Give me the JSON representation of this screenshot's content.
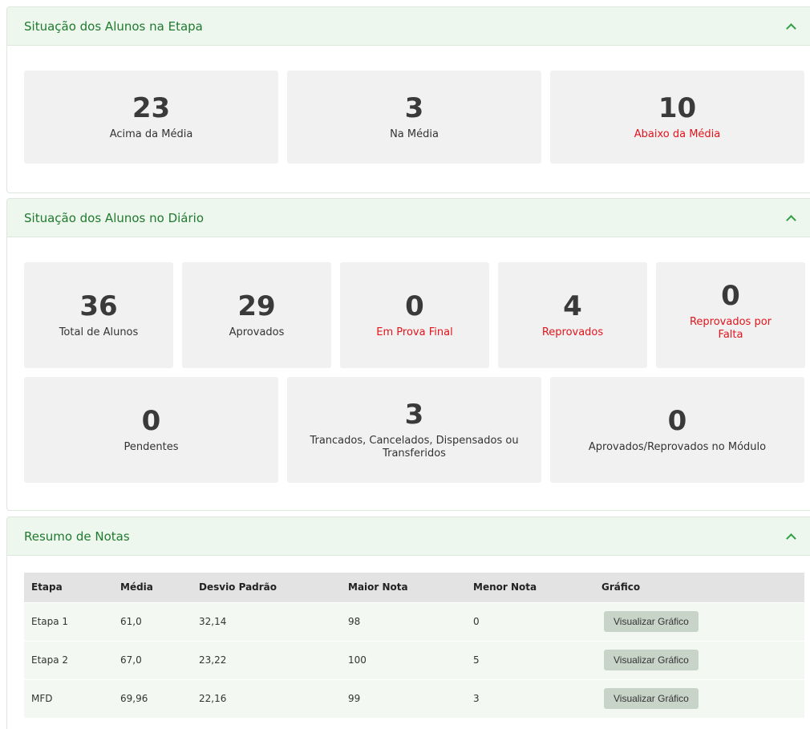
{
  "etapa_panel": {
    "title": "Situação dos Alunos na Etapa",
    "stats": [
      {
        "value": "23",
        "label": "Acima da Média",
        "alert": false
      },
      {
        "value": "3",
        "label": "Na Média",
        "alert": false
      },
      {
        "value": "10",
        "label": "Abaixo da Média",
        "alert": true
      }
    ]
  },
  "diario_panel": {
    "title": "Situação dos Alunos no Diário",
    "row1": [
      {
        "value": "36",
        "label": "Total de Alunos",
        "alert": false
      },
      {
        "value": "29",
        "label": "Aprovados",
        "alert": false
      },
      {
        "value": "0",
        "label": "Em Prova Final",
        "alert": true
      },
      {
        "value": "4",
        "label": "Reprovados",
        "alert": true
      },
      {
        "value": "0",
        "label": "Reprovados por Falta",
        "alert": true
      }
    ],
    "row2": [
      {
        "value": "0",
        "label": "Pendentes",
        "alert": false
      },
      {
        "value": "3",
        "label": "Trancados, Cancelados, Dispensados ou Transferidos",
        "alert": false
      },
      {
        "value": "0",
        "label": "Aprovados/Reprovados no Módulo",
        "alert": false
      }
    ]
  },
  "resumo_panel": {
    "title": "Resumo de Notas",
    "columns": [
      "Etapa",
      "Média",
      "Desvio Padrão",
      "Maior Nota",
      "Menor Nota",
      "Gráfico"
    ],
    "rows": [
      {
        "etapa": "Etapa 1",
        "media": "61,0",
        "desvio": "32,14",
        "maior": "98",
        "menor": "0",
        "button": "Visualizar Gráfico"
      },
      {
        "etapa": "Etapa 2",
        "media": "67,0",
        "desvio": "23,22",
        "maior": "100",
        "menor": "5",
        "button": "Visualizar Gráfico"
      },
      {
        "etapa": "MFD",
        "media": "69,96",
        "desvio": "22,16",
        "maior": "99",
        "menor": "3",
        "button": "Visualizar Gráfico"
      }
    ]
  },
  "colors": {
    "accent": "#1f7a2e",
    "alert": "#e3141b",
    "card_bg": "#f1f1f1",
    "header_bg": "#eef7ee"
  }
}
